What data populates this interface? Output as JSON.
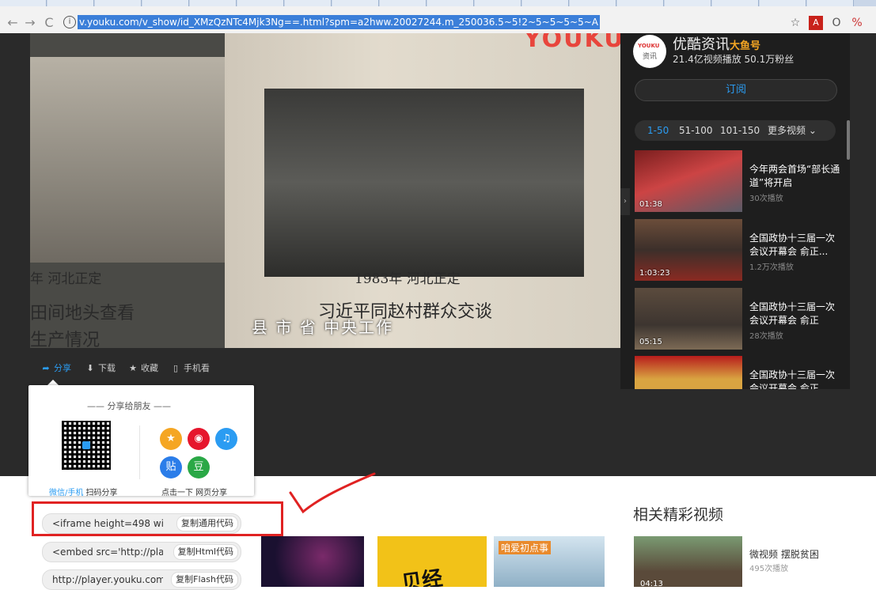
{
  "browser": {
    "url": "v.youku.com/v_show/id_XMzQzNTc4Mjk3Ng==.html?spm=a2hww.20027244.m_250036.5~5!2~5~5~5~5~A",
    "info_glyph": "i",
    "back_glyph": "←",
    "forward_glyph": "→",
    "reload_glyph": "C",
    "star_glyph": "☆",
    "pdf_glyph": "A",
    "ext1_glyph": "O",
    "ext2_glyph": "%",
    "tab_count": 18
  },
  "video": {
    "watermark": "YOUKU",
    "left_caption_1": "年  河北正定",
    "left_caption_2": "田间地头查看",
    "left_caption_3": "生产情况",
    "right_caption_1": "1983年  河北正定",
    "right_caption_2": "习近平同赵村群众交谈",
    "subtitle": "县  市  省  中央工作"
  },
  "actions": {
    "share": "分享",
    "download": "下载",
    "favorite": "收藏",
    "mobile": "手机看"
  },
  "channel": {
    "avatar_top": "YOUKU",
    "avatar_bottom": "资讯",
    "name": "优酷资讯",
    "badge": "大鱼号",
    "stats": "21.4亿视频播放 50.1万粉丝",
    "subscribe": "订阅"
  },
  "ranges": [
    "1-50",
    "51-100",
    "101-150",
    "更多视频"
  ],
  "playlist": [
    {
      "title": "今年两会首场“部长通道”将开启",
      "plays": "30次播放",
      "duration": "01:38"
    },
    {
      "title": "全国政协十三届一次会议开幕会 俞正...",
      "plays": "1.2万次播放",
      "duration": "1:03:23"
    },
    {
      "title": "全国政协十三届一次会议开幕会 俞正",
      "plays": "28次播放",
      "duration": "05:15"
    },
    {
      "title": "全国政协十三届一次会议开幕会 俞正",
      "plays": "",
      "duration": ""
    }
  ],
  "share": {
    "heading": "—— 分享给朋友 ——",
    "qr_caption_blue": "微信/手机",
    "qr_caption_rest": " 扫码分享",
    "social_caption": "点击一下 网页分享",
    "social_glyphs": [
      "★",
      "◉",
      "♫",
      "贴",
      "豆"
    ],
    "colors": {
      "qzone": "#f5a623",
      "weibo": "#e6162d",
      "qq": "#2b9cf2",
      "tieba": "#2b7de9",
      "douban": "#2aa846"
    }
  },
  "embed": [
    {
      "code": "<iframe height=498 wic",
      "button": "复制通用代码"
    },
    {
      "code": "<embed src='http://pla",
      "button": "复制Html代码"
    },
    {
      "code": "http://player.youku.com",
      "button": "复制Flash代码"
    }
  ],
  "related": {
    "heading": "相关精彩视频",
    "title": "微视频 摆脱贫困",
    "plays": "495次播放",
    "duration": "04:13",
    "thumb2_text": "贝经",
    "thumb3_text": "咱爱初点事"
  },
  "colors": {
    "accent": "#2b9cf2",
    "annotation": "#e02222"
  }
}
